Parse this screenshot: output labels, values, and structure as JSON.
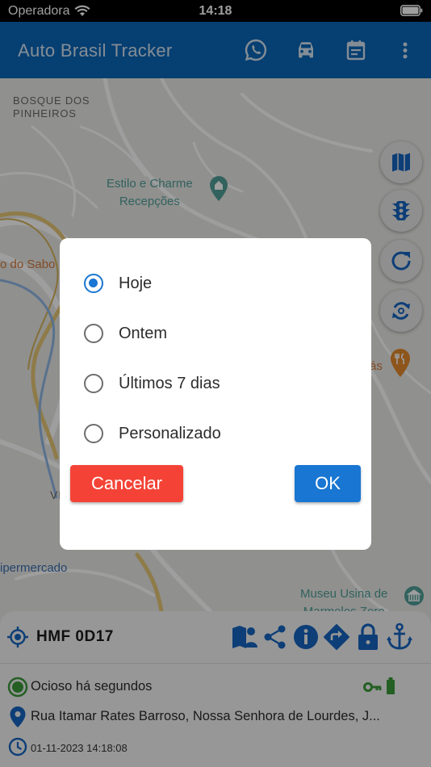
{
  "status_bar": {
    "carrier": "Operadora",
    "time": "14:18"
  },
  "app_bar": {
    "title": "Auto Brasil Tracker",
    "icons": [
      "whatsapp-icon",
      "car-icon",
      "calendar-icon",
      "more-vert-icon"
    ]
  },
  "map": {
    "labels": {
      "bosque": "BOSQUE DOS\nPINHEIROS",
      "estilo": "Estilo e Charme\nRecepções",
      "sabo": "o do Sabo",
      "supermercado": "ipermercado",
      "museu": "Museu Usina de\nMarmelos Zero",
      "as": "ás",
      "vi": "VI"
    },
    "buttons": [
      "map-layers-icon",
      "traffic-light-icon",
      "refresh-icon",
      "sync-icon"
    ]
  },
  "dialog": {
    "options": [
      {
        "label": "Hoje",
        "selected": true
      },
      {
        "label": "Ontem",
        "selected": false
      },
      {
        "label": "Últimos 7 dias",
        "selected": false
      },
      {
        "label": "Personalizado",
        "selected": false
      }
    ],
    "cancel_label": "Cancelar",
    "ok_label": "OK"
  },
  "vehicle": {
    "plate": "HMF 0D17",
    "status": "Ocioso há segundos",
    "address": "Rua Itamar Rates Barroso, Nossa Senhora de Lourdes, J...",
    "datetime": "01-11-2023 14:18:08"
  },
  "colors": {
    "primary": "#0a67b6",
    "accent": "#1976d2",
    "cancel": "#f44336",
    "status_green": "#3a9a3a",
    "icon_blue": "#1565c0"
  }
}
